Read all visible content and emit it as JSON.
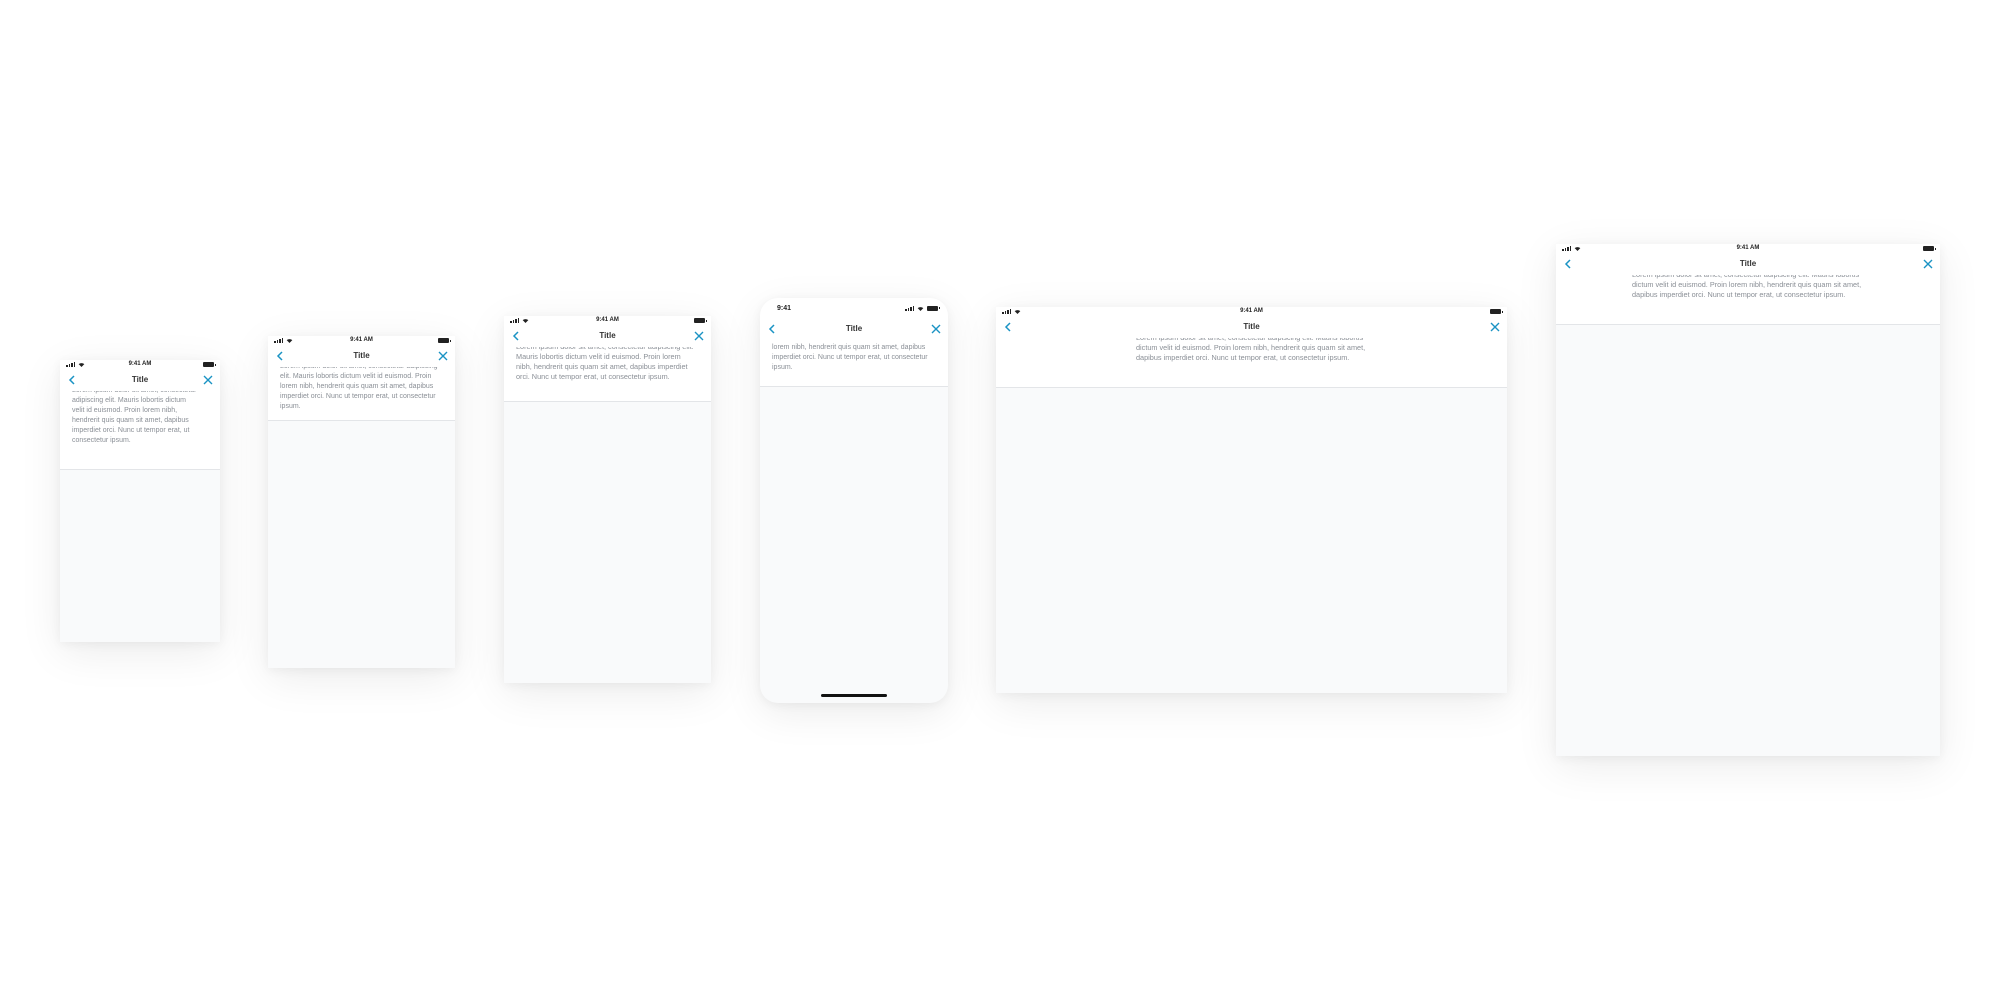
{
  "status_bar": {
    "time": "9:41 AM",
    "time_short": "9:41"
  },
  "nav": {
    "title": "Title",
    "back_icon": "chevron-left-icon",
    "close_icon": "close-icon"
  },
  "body_text": "Lorem ipsum dolor sit amet, consectetur adipiscing elit. Mauris lobortis dictum velit id euismod. Proin lorem nibh, hendrerit quis quam sit amet, dapibus imperdiet orci. Nunc ut tempor erat, ut consectetur ipsum.",
  "colors": {
    "accent": "#1a93c4",
    "text": "#8a8f96",
    "background": "#f9fafb"
  }
}
